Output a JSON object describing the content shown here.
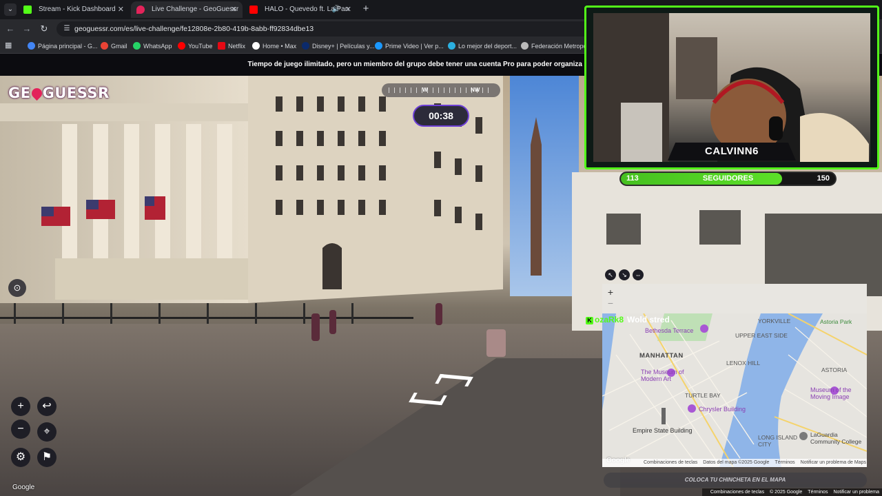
{
  "browser": {
    "tabs": [
      {
        "title": "Stream - Kick Dashboard",
        "active": false,
        "favicon_color": "#53fc18"
      },
      {
        "title": "Live Challenge - GeoGuessr",
        "active": true,
        "favicon_color": "#e3235a"
      },
      {
        "title": "HALO - Quevedo ft. La Pan",
        "active": false,
        "favicon_color": "#ff0000"
      }
    ],
    "url": "geoguessr.com/es/live-challenge/fe12808e-2b80-419b-8abb-ff92834dbe13",
    "bookmarks": [
      {
        "label": "Página principal - G...",
        "color": "#4285f4"
      },
      {
        "label": "Gmail",
        "color": "#ea4335"
      },
      {
        "label": "WhatsApp",
        "color": "#25d366"
      },
      {
        "label": "YouTube",
        "color": "#ff0000"
      },
      {
        "label": "Netflix",
        "color": "#e50914"
      },
      {
        "label": "Home • Max",
        "color": "#ffffff"
      },
      {
        "label": "Disney+ | Películas y...",
        "color": "#0b2a6b"
      },
      {
        "label": "Prime Video | Ver p...",
        "color": "#1a98ff"
      },
      {
        "label": "Lo mejor del deport...",
        "color": "#2bb0e0"
      },
      {
        "label": "Federación Metropo...",
        "color": "#bbbbbb"
      }
    ]
  },
  "game": {
    "banner": "Tiempo de juego ilimitado, pero un miembro del grupo debe tener una cuenta Pro para poder organiza",
    "logo_before": "GE",
    "logo_after": "GUESSR",
    "compass": {
      "w": "W",
      "nw": "NW"
    },
    "timer": "00:38",
    "controls": {
      "zoom_in": "+",
      "zoom_out": "−",
      "undo": "↩",
      "checkpoint": "⌖",
      "settings": "⚙",
      "flag": "⚑"
    },
    "watermark": "Google",
    "place_pin": "COLOCA TU CHINCHETA EN EL MAPA"
  },
  "stream": {
    "streamer": "CALVINN6",
    "followers": {
      "current": "113",
      "label": "SEGUIDORES",
      "goal": "150",
      "progress": 0.7533
    },
    "chat": {
      "badge": "K",
      "user": "ozaRk8",
      "message": "Wold stred"
    }
  },
  "map": {
    "zoom_in": "+",
    "zoom_out": "−",
    "labels": [
      {
        "text": "YORKVILLE",
        "type": "area"
      },
      {
        "text": "Astoria Park",
        "type": "park"
      },
      {
        "text": "Bethesda Terrace",
        "type": "poi"
      },
      {
        "text": "UPPER EAST SIDE",
        "type": "area"
      },
      {
        "text": "MANHATTAN",
        "type": "big"
      },
      {
        "text": "LENOX HILL",
        "type": "area"
      },
      {
        "text": "ASTORIA",
        "type": "area"
      },
      {
        "text": "The Museum of Modern Art",
        "type": "poi"
      },
      {
        "text": "Museum of the Moving Image",
        "type": "poi"
      },
      {
        "text": "TURTLE BAY",
        "type": "area"
      },
      {
        "text": "Chrysler Building",
        "type": "poi"
      },
      {
        "text": "Empire State Building",
        "type": "area"
      },
      {
        "text": "LONG ISLAND CITY",
        "type": "area"
      },
      {
        "text": "LaGuardia Community College",
        "type": "area"
      }
    ],
    "footer": [
      "Combinaciones de teclas",
      "Datos del mapa ©2025 Google",
      "Términos",
      "Notificar un problema de Maps"
    ],
    "google": "Google"
  },
  "page_footer": [
    "Combinaciones de teclas",
    "© 2025 Google",
    "Términos",
    "Notificar un problema"
  ]
}
